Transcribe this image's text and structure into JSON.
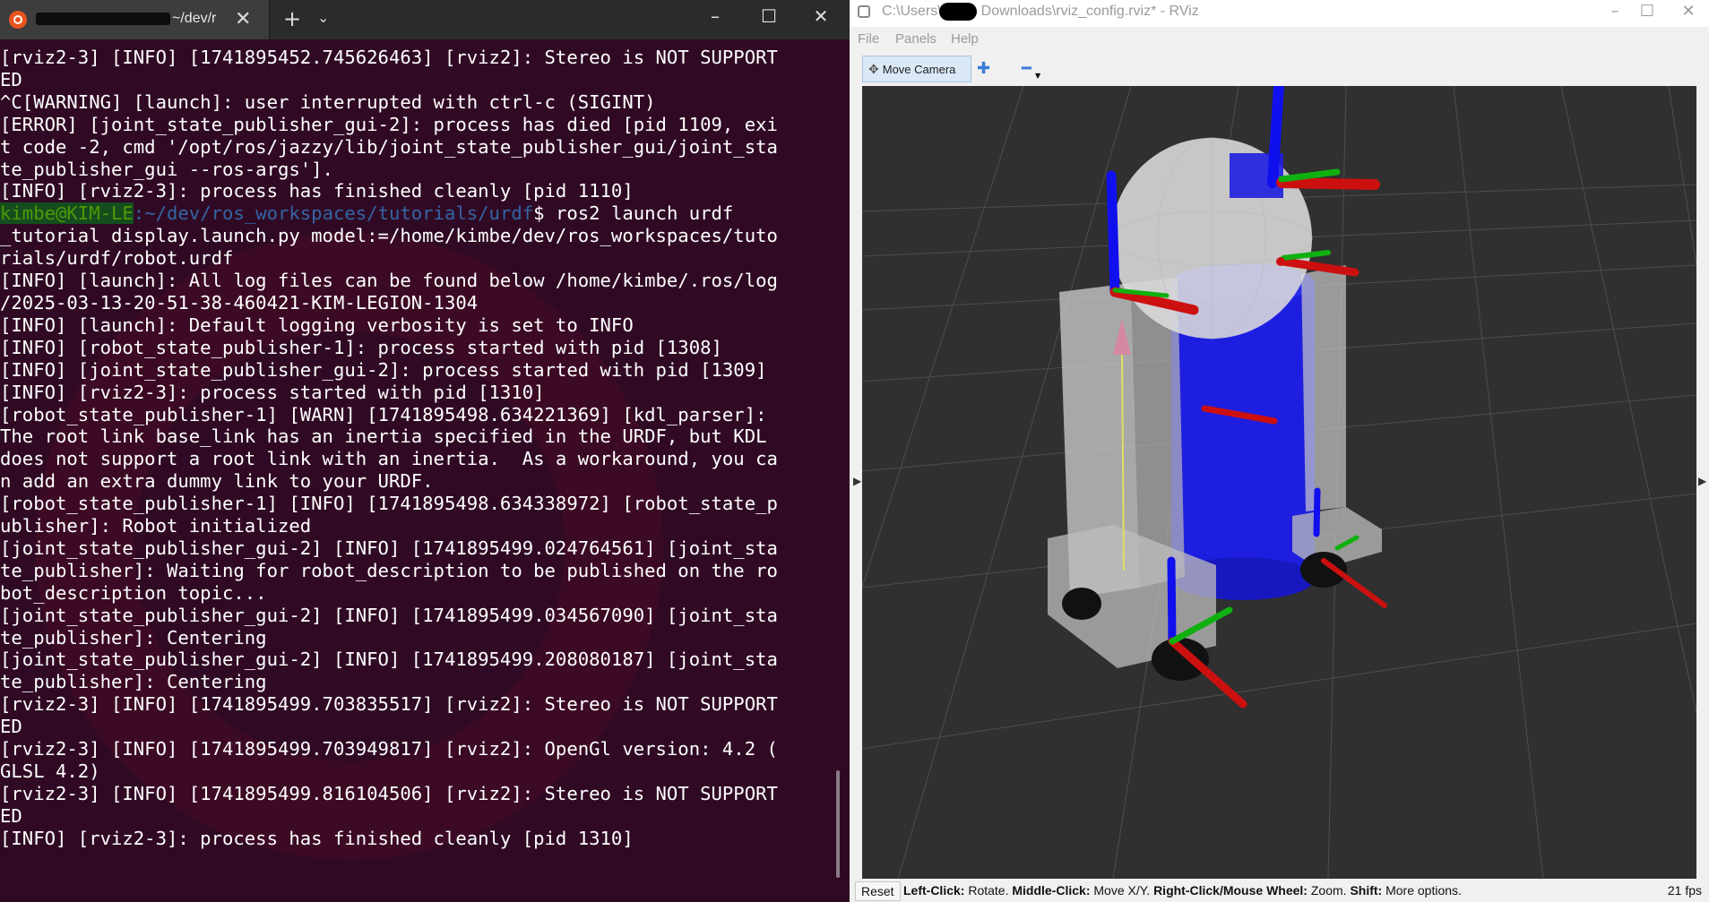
{
  "terminal": {
    "tab_title": "~/dev/r",
    "output_before_prompt": [
      "[rviz2-3] [INFO] [1741895452.745626463] [rviz2]: Stereo is NOT SUPPORT",
      "ED",
      "^C[WARNING] [launch]: user interrupted with ctrl-c (SIGINT)",
      "[ERROR] [joint_state_publisher_gui-2]: process has died [pid 1109, exi",
      "t code -2, cmd '/opt/ros/jazzy/lib/joint_state_publisher_gui/joint_sta",
      "te_publisher_gui --ros-args'].",
      "[INFO] [rviz2-3]: process has finished cleanly [pid 1110]"
    ],
    "prompt_user": "kimbe@KIM-LE",
    "prompt_path": ":~/dev/ros_workspaces/tutorials/urdf",
    "command": "$ ros2 launch urdf",
    "output_after_prompt": [
      "_tutorial display.launch.py model:=/home/kimbe/dev/ros_workspaces/tuto",
      "rials/urdf/robot.urdf",
      "[INFO] [launch]: All log files can be found below /home/kimbe/.ros/log",
      "/2025-03-13-20-51-38-460421-KIM-LEGION-1304",
      "[INFO] [launch]: Default logging verbosity is set to INFO",
      "[INFO] [robot_state_publisher-1]: process started with pid [1308]",
      "[INFO] [joint_state_publisher_gui-2]: process started with pid [1309]",
      "[INFO] [rviz2-3]: process started with pid [1310]",
      "[robot_state_publisher-1] [WARN] [1741895498.634221369] [kdl_parser]:",
      "The root link base_link has an inertia specified in the URDF, but KDL",
      "does not support a root link with an inertia.  As a workaround, you ca",
      "n add an extra dummy link to your URDF.",
      "[robot_state_publisher-1] [INFO] [1741895498.634338972] [robot_state_p",
      "ublisher]: Robot initialized",
      "[joint_state_publisher_gui-2] [INFO] [1741895499.024764561] [joint_sta",
      "te_publisher]: Waiting for robot_description to be published on the ro",
      "bot_description topic...",
      "[joint_state_publisher_gui-2] [INFO] [1741895499.034567090] [joint_sta",
      "te_publisher]: Centering",
      "[joint_state_publisher_gui-2] [INFO] [1741895499.208080187] [joint_sta",
      "te_publisher]: Centering",
      "[rviz2-3] [INFO] [1741895499.703835517] [rviz2]: Stereo is NOT SUPPORT",
      "ED",
      "[rviz2-3] [INFO] [1741895499.703949817] [rviz2]: OpenGl version: 4.2 (",
      "GLSL 4.2)",
      "[rviz2-3] [INFO] [1741895499.816104506] [rviz2]: Stereo is NOT SUPPORT",
      "ED",
      "[INFO] [rviz2-3]: process has finished cleanly [pid 1310]"
    ]
  },
  "rviz": {
    "title_prefix": "C:\\Users\\",
    "title_suffix": "Downloads\\rviz_config.rviz* - RViz",
    "menu": [
      "File",
      "Panels",
      "Help"
    ],
    "toolbar": {
      "move_camera": "Move Camera"
    },
    "status": {
      "reset": "Reset",
      "h1": "Left-Click:",
      "t1": " Rotate. ",
      "h2": "Middle-Click:",
      "t2": " Move X/Y. ",
      "h3": "Right-Click/Mouse Wheel:",
      "t3": " Zoom. ",
      "h4": "Shift:",
      "t4": " More options.",
      "fps": "21 fps"
    }
  },
  "colors": {
    "terminal_bg": "#300a24",
    "viewport_bg": "#303030",
    "robot_blue": "#1e1ee0",
    "axis_red": "#cc1010",
    "axis_green": "#10b010",
    "axis_blue": "#1010ee"
  }
}
